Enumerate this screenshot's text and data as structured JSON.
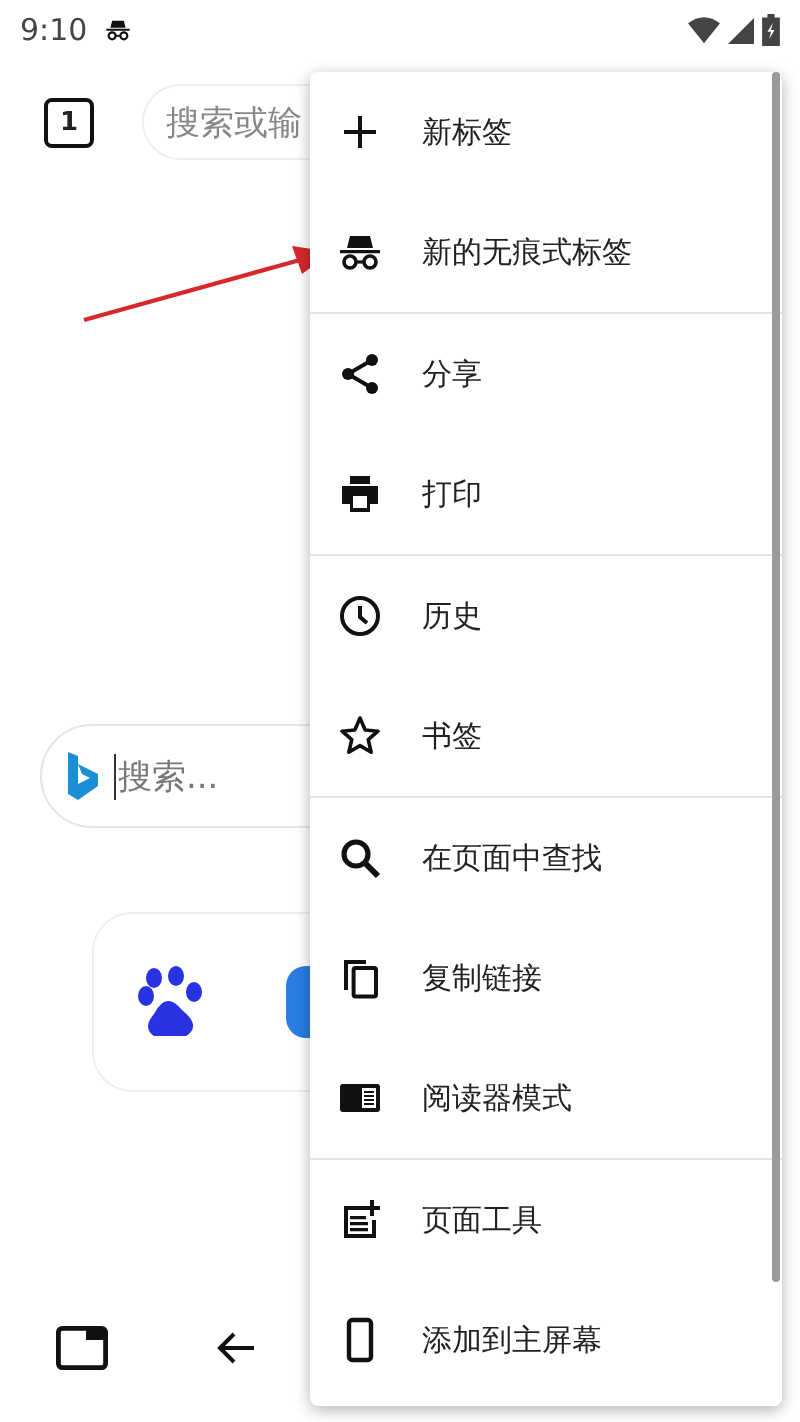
{
  "status_bar": {
    "time": "9:10"
  },
  "toolbar": {
    "tab_count": "1",
    "address": {
      "placeholder": "搜索或输"
    }
  },
  "search_box": {
    "placeholder": "搜索..."
  },
  "menu": {
    "groups": [
      [
        {
          "label": "新标签"
        },
        {
          "label": "新的无痕式标签"
        }
      ],
      [
        {
          "label": "分享"
        },
        {
          "label": "打印"
        }
      ],
      [
        {
          "label": "历史"
        },
        {
          "label": "书签"
        }
      ],
      [
        {
          "label": "在页面中查找"
        },
        {
          "label": "复制链接"
        },
        {
          "label": "阅读器模式"
        }
      ],
      [
        {
          "label": "页面工具"
        },
        {
          "label": "添加到主屏幕"
        }
      ]
    ]
  }
}
